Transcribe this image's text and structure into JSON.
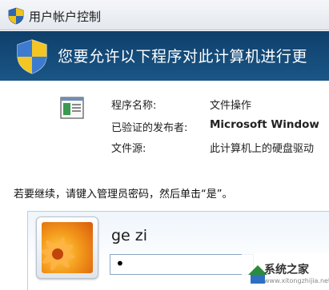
{
  "window": {
    "title": "用户帐户控制"
  },
  "header": {
    "message": "您要允许以下程序对此计算机进行更"
  },
  "program": {
    "name_label": "程序名称:",
    "name_value": "文件操作",
    "publisher_label": "已验证的发布者:",
    "publisher_value": "Microsoft Window",
    "source_label": "文件源:",
    "source_value": "此计算机上的硬盘驱动"
  },
  "instruction": "若要继续，请键入管理员密码，然后单击“是”。",
  "credential": {
    "username": "ge zi",
    "password_value": "•"
  },
  "watermark": {
    "text": "系统之家",
    "url": "www.xitongzhijia.net"
  },
  "colors": {
    "header_bg": "#1a5686",
    "title_bg": "#e4e8ee",
    "cred_border": "#b7cfe9"
  }
}
